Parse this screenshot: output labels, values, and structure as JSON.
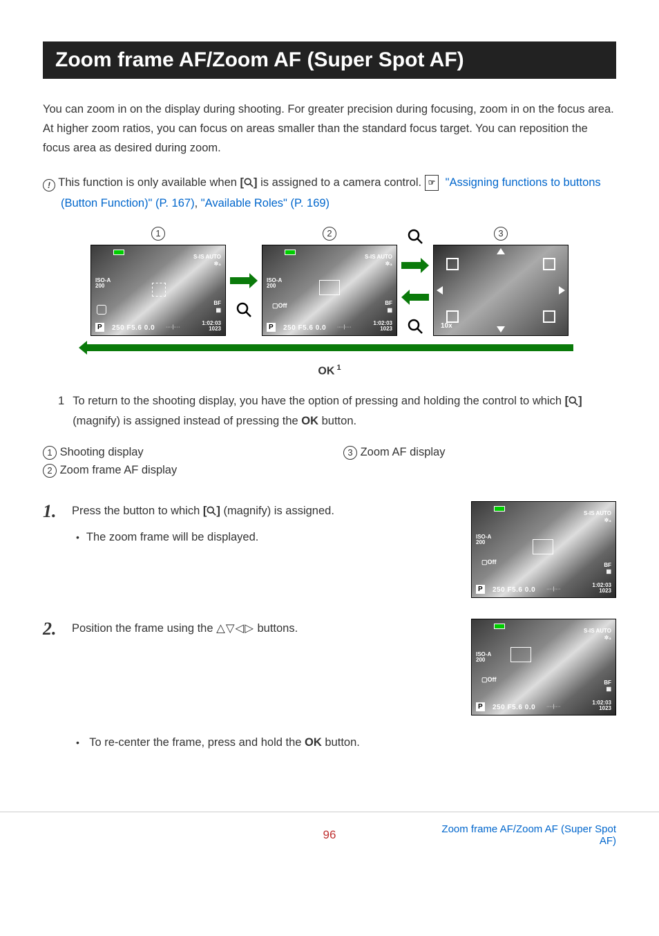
{
  "title": "Zoom frame AF/Zoom AF (Super Spot AF)",
  "intro": "You can zoom in on the display during shooting. For greater precision during focusing, zoom in on the focus area. At higher zoom ratios, you can focus on areas smaller than the standard focus target. You can reposition the focus area as desired during zoom.",
  "note": {
    "prefix": "This function is only available when ",
    "mid": " is assigned to a camera control. ",
    "link1": "\"Assigning functions to buttons (Button Function)\" (P. 167)",
    "sep": ", ",
    "link2": "\"Available Roles\" (P. 169)"
  },
  "diagram": {
    "labels": {
      "l1": "1",
      "l2": "2",
      "l3": "3"
    },
    "ok": "OK",
    "ok_sup": "1",
    "shot": {
      "sis": "S-IS AUTO",
      "burst": "✲₃",
      "iso_a": "ISO-A",
      "iso_v": "200",
      "p": "P",
      "bottom": "250  F5.6   0.0",
      "scale": "····|····",
      "time": "1:02:03",
      "frames": "1023",
      "off": "Off",
      "bf": "BF",
      "tenx": "10x"
    }
  },
  "footnote": {
    "num": "1",
    "text_a": "To return to the shooting display, you have the option of pressing and holding the control to which ",
    "text_b": " (magnify) is assigned instead of pressing the ",
    "ok": "OK",
    "text_c": " button."
  },
  "callouts": {
    "c1": "Shooting display",
    "c2": "Zoom frame AF display",
    "c3": "Zoom AF display"
  },
  "steps": {
    "s1": {
      "num": "1.",
      "text_a": "Press the button to which ",
      "text_b": " (magnify) is assigned.",
      "bullet": "The zoom frame will be displayed."
    },
    "s2": {
      "num": "2.",
      "text_a": "Position the frame using the ",
      "text_b": " buttons.",
      "bullet_a": "To re-center the frame, press and hold the ",
      "ok": "OK",
      "bullet_b": " button."
    }
  },
  "footer": {
    "page": "96",
    "breadcrumb": "Zoom frame AF/Zoom AF (Super Spot AF)"
  }
}
